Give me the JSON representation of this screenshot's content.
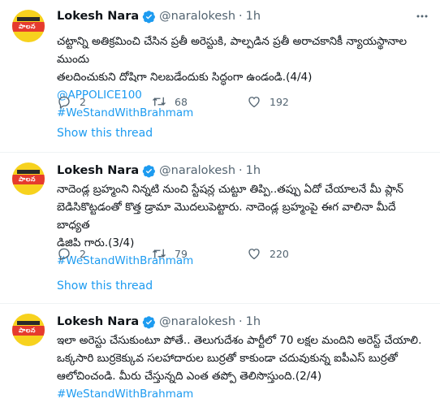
{
  "tweets": [
    {
      "author": {
        "name": "Lokesh Nara",
        "handle": "@naralokesh",
        "dot": "·",
        "time": "1h",
        "avatar_text": "పాలన"
      },
      "text_lines": [
        "చట్టాన్ని అతిక్రమించి చేసిన ప్రతీ అరెస్టుకి, పాల్పడిన ప్రతీ అరాచకానికీ న్యాయస్థానాల ముందు",
        "తలదించుకుని దోషిగా నిలబడేందుకు సిద్ధంగా ఉండండి.(4/4)"
      ],
      "links": [
        "@APPOLICE100",
        "#WeStandWithBrahmam"
      ],
      "stats": {
        "replies": "2",
        "retweets": "68",
        "likes": "192"
      },
      "show_thread": "Show this thread"
    },
    {
      "author": {
        "name": "Lokesh Nara",
        "handle": "@naralokesh",
        "dot": "·",
        "time": "1h",
        "avatar_text": "పాలన"
      },
      "text_lines": [
        "నాదెండ్ల బ్రహ్మంని నిన్నటి నుంచి స్టేషన్ల చుట్టూ తిప్పి..తప్పు ఏదో చేయాలనే మీ ప్లాన్",
        "బెడిసికొట్టడంతో కొత్త డ్రామా మొదలుపెట్టారు. నాదెండ్ల బ్రహ్మంపై ఈగ వాలినా మీదే బాధ్యత",
        "డిజిపి గారు.(3/4)"
      ],
      "links": [
        "#WeStandWithBrahmam"
      ],
      "stats": {
        "replies": "2",
        "retweets": "79",
        "likes": "220"
      },
      "show_thread": "Show this thread"
    },
    {
      "author": {
        "name": "Lokesh Nara",
        "handle": "@naralokesh",
        "dot": "·",
        "time": "1h",
        "avatar_text": "పాలన"
      },
      "text_lines": [
        "ఇలా అరెస్టు చేసుకుంటూ పోతే.. తెలుగుదేశం పార్టీలో 70 లక్షల మందిని అరెస్ట్ చేయాలి.",
        "ఒక్కసారి బుర్రకెక్కువ సలహాదారుల బుర్రతో కాకుండా చదువుకున్న ఐపీఎస్ బుర్రతో",
        "ఆలోచించండి. మీరు చేస్తున్నది ఎంత తప్పో తెలిసొస్తుంది.(2/4)"
      ],
      "links": [
        "#WeStandWithBrahmam"
      ]
    }
  ],
  "colors": {
    "accent": "#1d9bf0",
    "muted": "#536471",
    "text": "#0f1419"
  },
  "icons": [
    "verified-badge-icon",
    "more-options-icon",
    "reply-icon",
    "retweet-icon",
    "like-icon"
  ]
}
